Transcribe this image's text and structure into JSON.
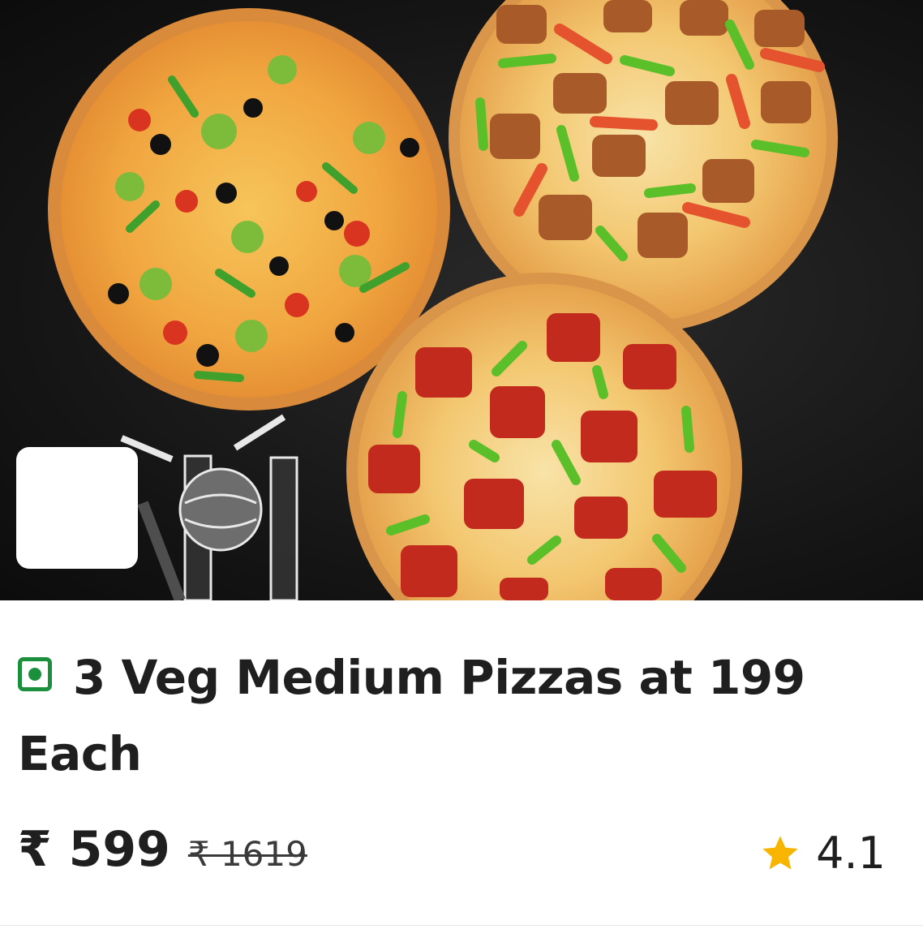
{
  "product": {
    "title": "3 Veg Medium Pizzas at 199 Each",
    "price": "₹ 599",
    "original_price": "₹ 1619",
    "rating": "4.1",
    "veg_indicator": "veg-icon",
    "rating_icon": "star-icon"
  },
  "colors": {
    "veg_green": "#1a8f3c",
    "star_yellow": "#f7b500",
    "text": "#1f1f1f",
    "hero_bg": "#141414"
  }
}
